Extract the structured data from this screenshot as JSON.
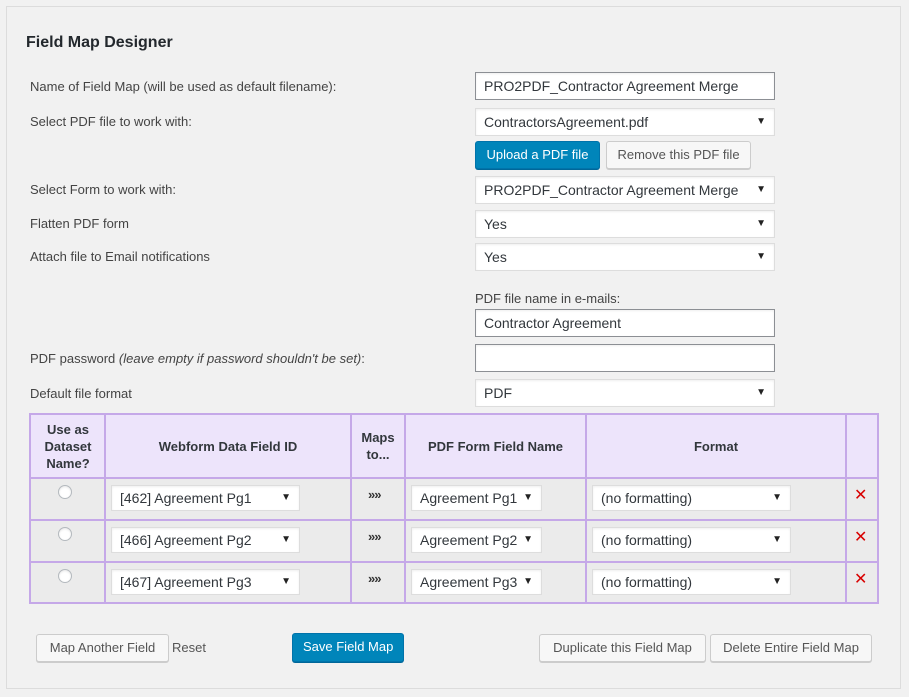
{
  "page": {
    "title": "Field Map Designer"
  },
  "form": {
    "name_label": "Name of Field Map (will be used as default filename):",
    "name_value": "PRO2PDF_Contractor Agreement Merge",
    "pdf_label": "Select PDF file to work with:",
    "pdf_value": "ContractorsAgreement.pdf",
    "upload_label": "Upload a PDF file",
    "remove_label": "Remove this PDF file",
    "form_label": "Select Form to work with:",
    "form_value": "PRO2PDF_Contractor Agreement Merge",
    "flatten_label": "Flatten PDF form",
    "flatten_value": "Yes",
    "attach_label": "Attach file to Email notifications",
    "attach_value": "Yes",
    "email_name_label": "PDF file name in e-mails:",
    "email_name_value": "Contractor Agreement",
    "password_label": "PDF password",
    "password_hint": "(leave empty if password shouldn't be set)",
    "password_colon": ":",
    "password_value": "",
    "format_label": "Default file format",
    "format_value": "PDF"
  },
  "grid": {
    "headers": {
      "dataset": "Use as Dataset Name?",
      "webform": "Webform Data Field ID",
      "maps": "Maps to...",
      "pdf": "PDF Form Field Name",
      "format": "Format"
    },
    "maps_glyph": "»»",
    "delete_glyph": "✕",
    "rows": [
      {
        "webform": "[462] Agreement Pg1",
        "pdf": "Agreement Pg1",
        "format": "(no formatting)"
      },
      {
        "webform": "[466] Agreement Pg2",
        "pdf": "Agreement Pg2",
        "format": "(no formatting)"
      },
      {
        "webform": "[467] Agreement Pg3",
        "pdf": "Agreement Pg3",
        "format": "(no formatting)"
      }
    ]
  },
  "footer": {
    "map_another": "Map Another Field",
    "reset": "Reset",
    "save": "Save Field Map",
    "duplicate": "Duplicate this Field Map",
    "delete_map": "Delete Entire Field Map"
  },
  "icons": {
    "dropdown": "▼"
  },
  "colors": {
    "primary": "#0085ba",
    "grid_border": "#c5a8e8",
    "grid_header": "#ede4fb",
    "delete": "#d80000"
  }
}
